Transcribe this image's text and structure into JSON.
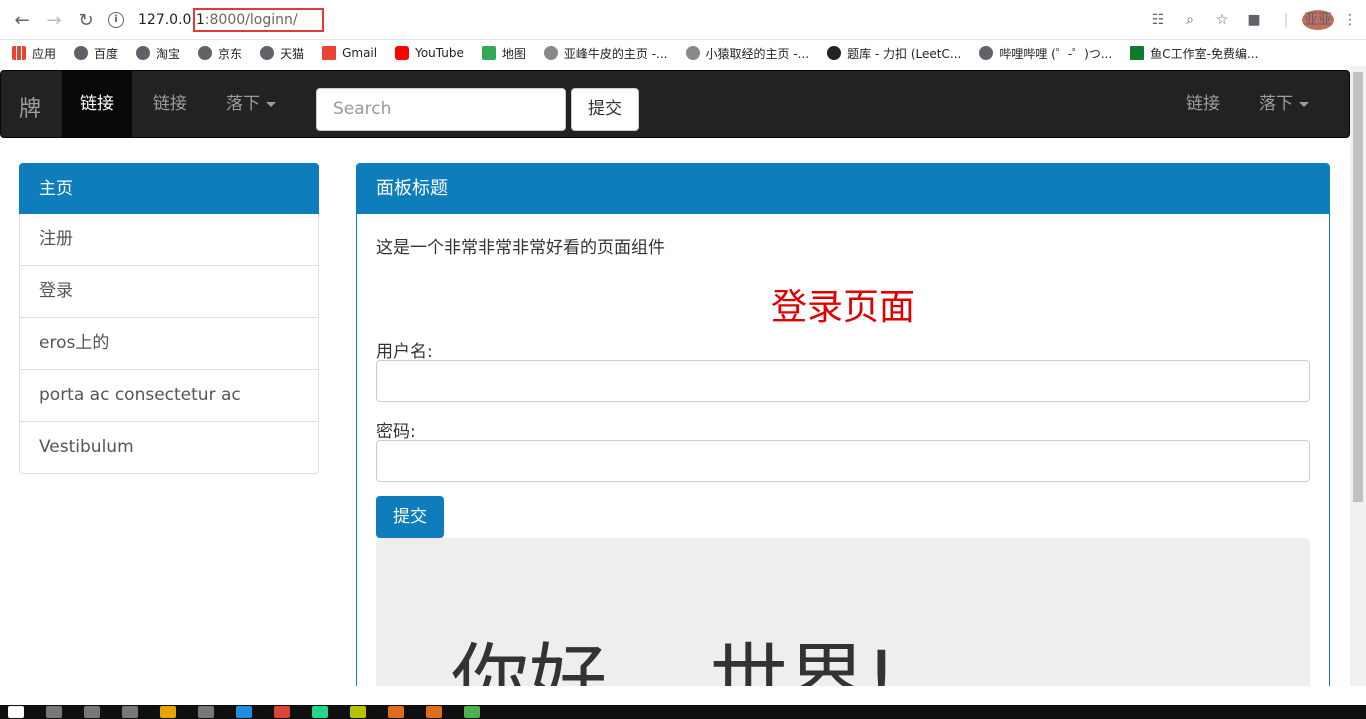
{
  "browser": {
    "url_host": "127.0.0.1",
    "url_path": ":8000/loginn/",
    "avatar_text": "亚亚"
  },
  "bookmarks": [
    {
      "label": "应用",
      "color": "#e8710a"
    },
    {
      "label": "百度",
      "color": "#5f6368"
    },
    {
      "label": "淘宝",
      "color": "#5f6368"
    },
    {
      "label": "京东",
      "color": "#5f6368"
    },
    {
      "label": "天猫",
      "color": "#5f6368"
    },
    {
      "label": "Gmail",
      "color": "#ea4335"
    },
    {
      "label": "YouTube",
      "color": "#ff0000"
    },
    {
      "label": "地图",
      "color": "#34a853"
    },
    {
      "label": "亚峰牛皮的主页 -...",
      "color": "#5f6368"
    },
    {
      "label": "小猿取经的主页 -...",
      "color": "#5f6368"
    },
    {
      "label": "题库 - 力扣 (LeetC...",
      "color": "#222222"
    },
    {
      "label": "哔哩哔哩 (゜-゜)つ...",
      "color": "#5f6368"
    },
    {
      "label": "鱼C工作室-免费编...",
      "color": "#0b7d2e"
    }
  ],
  "navbar": {
    "brand": "牌",
    "link_active": "链接",
    "link": "链接",
    "dropdown": "落下",
    "search_placeholder": "Search",
    "submit": "提交",
    "right_link": "链接",
    "right_dropdown": "落下"
  },
  "sidebar": {
    "items": [
      {
        "label": "主页"
      },
      {
        "label": "注册"
      },
      {
        "label": "登录"
      },
      {
        "label": "eros上的"
      },
      {
        "label": "porta ac consectetur ac"
      },
      {
        "label": "Vestibulum"
      }
    ]
  },
  "panel": {
    "title": "面板标题",
    "text": "这是一个非常非常非常好看的页面组件",
    "login_title": "登录页面",
    "username_label": "用户名:",
    "password_label": "密码:",
    "submit": "提交",
    "jumbotron": "你好， 世界!"
  }
}
